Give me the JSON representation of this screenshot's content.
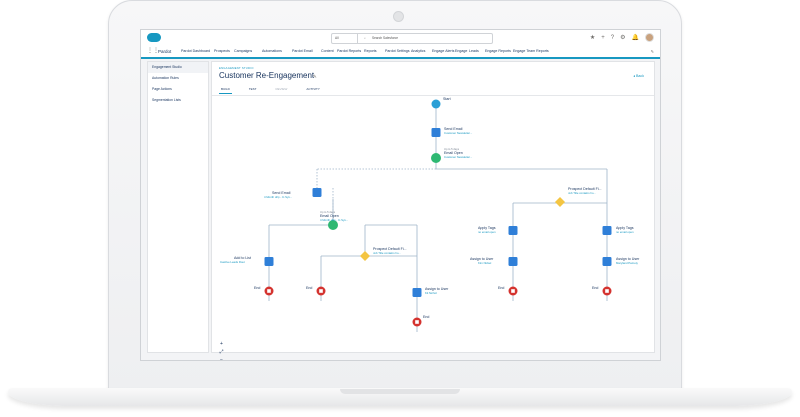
{
  "global_search": {
    "scope": "All",
    "placeholder": "Search Salesforce"
  },
  "app_name": "Pardot",
  "nav_items": [
    "Pardot Dashboard",
    "Prospects",
    "Campaigns",
    "Automations",
    "Pardot Email",
    "Content",
    "Pardot Reports",
    "Reports",
    "Pardot Settings",
    "Analytics",
    "Engage Alerts",
    "Engage",
    "Leads",
    "Engage Reports",
    "Engage Team Reports"
  ],
  "active_nav": "Automations",
  "sidebar_items": [
    "Engagement Studio",
    "Automation Rules",
    "Page Actions",
    "Segmentation Lists"
  ],
  "page": {
    "eyebrow": "ENGAGEMENT STUDIO",
    "title": "Customer Re-Engagement",
    "back": "Back",
    "tabs": [
      "BUILD",
      "TEST",
      "REVIEW",
      "ACTIVITY"
    ],
    "active_tab": "BUILD"
  },
  "colors": {
    "brand": "#1798c1",
    "action": "#2f7fd8",
    "trigger": "#2eb872",
    "rule": "#f4c542",
    "end": "#d4332f",
    "start": "#2a9fd6"
  },
  "flow": {
    "start": {
      "label": "Start",
      "icon": "drop-icon"
    },
    "send_email_1": {
      "label": "Send Email",
      "sub": "Customer Newsletter...",
      "note": ""
    },
    "email_open_1": {
      "label": "Email Open",
      "sub": "Customer Newsletter...",
      "note": "Up to 5 days"
    },
    "send_email_2": {
      "label": "Send Email",
      "sub": "4 Month drip - In Sys...",
      "note": ""
    },
    "email_open_2": {
      "label": "Email Open",
      "sub": "4 Month drip - In Sys...",
      "note": "Up to 5 days"
    },
    "rule_right": {
      "label": "Prospect Default Fi...",
      "sub": "Job Title contains ho..."
    },
    "rule_mid": {
      "label": "Prospect Default Fi...",
      "sub": "Job Title contains ho..."
    },
    "add_to_list": {
      "label": "Add to List",
      "sub": "Inactive Leads Rout"
    },
    "apply_tags": {
      "label": "Apply Tags",
      "sub": "no email open"
    },
    "apply_tags_2": {
      "label": "Apply Tags",
      "sub": "no email open"
    },
    "assign_user_1": {
      "label": "Assign to User",
      "sub": "Kit Nichol"
    },
    "assign_user_2": {
      "label": "Assign to User",
      "sub": "Kim Nickel"
    },
    "assign_user_3": {
      "label": "Assign to User",
      "sub": "Maryland Parnety"
    },
    "end_label": "End"
  },
  "zoom_controls": [
    "+",
    "⤢",
    "−"
  ]
}
